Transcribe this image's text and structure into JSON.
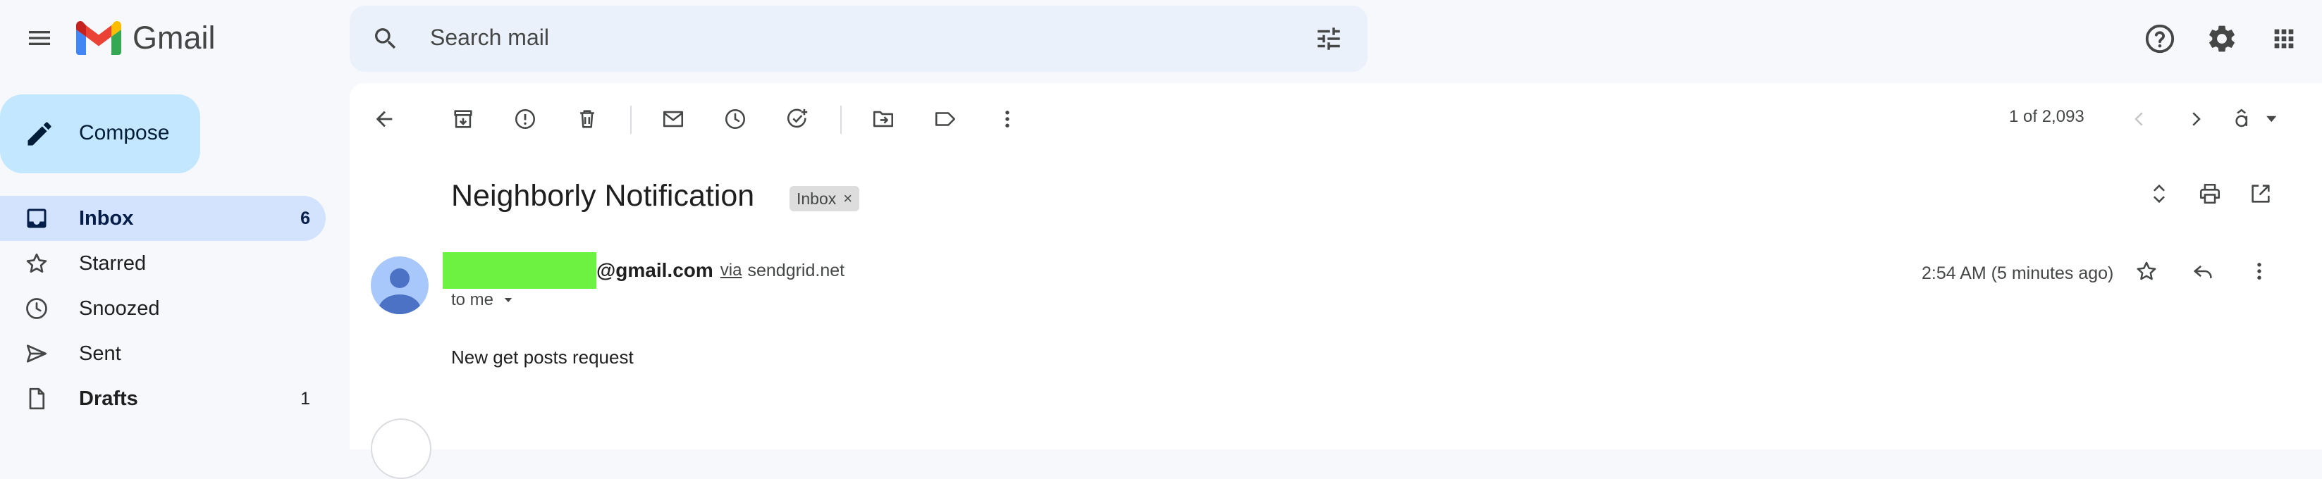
{
  "app": {
    "name": "Gmail"
  },
  "search": {
    "placeholder": "Search mail"
  },
  "compose": {
    "label": "Compose"
  },
  "sidebar": {
    "items": [
      {
        "label": "Inbox",
        "count": "6",
        "icon": "inbox-icon"
      },
      {
        "label": "Starred",
        "count": "",
        "icon": "star-icon"
      },
      {
        "label": "Snoozed",
        "count": "",
        "icon": "clock-icon"
      },
      {
        "label": "Sent",
        "count": "",
        "icon": "send-icon"
      },
      {
        "label": "Drafts",
        "count": "1",
        "icon": "draft-icon"
      }
    ]
  },
  "toolbar": {
    "pager_text": "1 of 2,093"
  },
  "email": {
    "subject": "Neighborly Notification",
    "label_chip": "Inbox",
    "label_remove": "×",
    "sender_email": "@gmail.com",
    "via_label": "via",
    "via_domain": "sendgrid.net",
    "recipient": "to me",
    "timestamp": "2:54 AM (5 minutes ago)",
    "body": "New get posts request"
  },
  "colors": {
    "background": "#f6f8fc",
    "search_bg": "#eaf1fb",
    "compose_bg": "#c2e7ff",
    "active_nav": "#d3e3fd",
    "redaction": "#6df241",
    "avatar_bg": "#a8c7fa"
  }
}
